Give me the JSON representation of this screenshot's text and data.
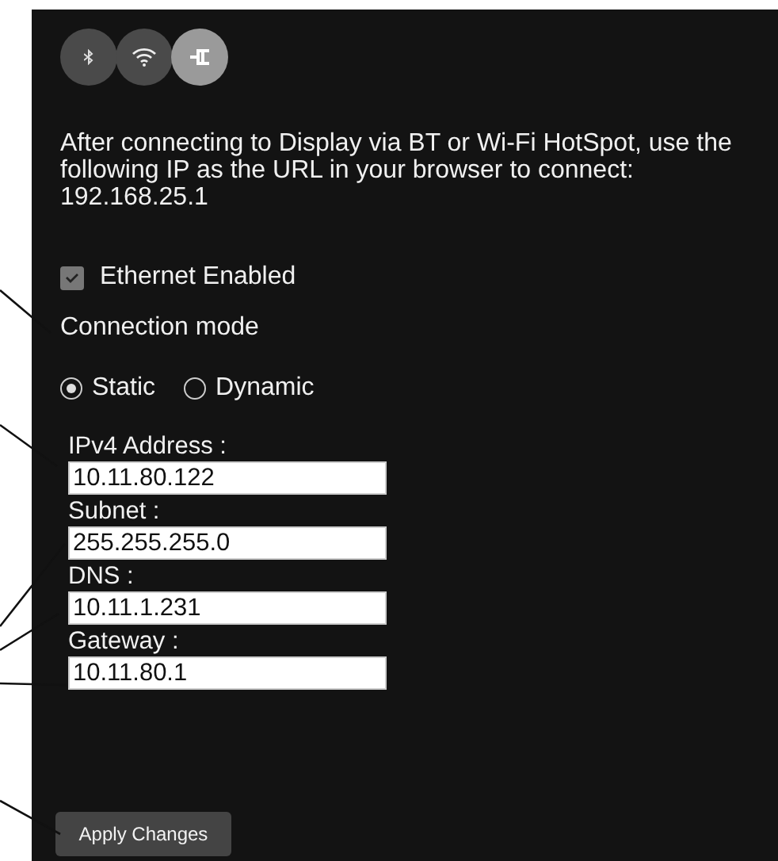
{
  "tabs": [
    {
      "kind": "bluetooth",
      "selected": false
    },
    {
      "kind": "wifi",
      "selected": false
    },
    {
      "kind": "ethernet",
      "selected": true
    }
  ],
  "info": "After connecting to Display via BT or Wi-Fi HotSpot, use the following IP as the URL in your browser to connect: 192.168.25.1",
  "ethernet_enabled": {
    "label": "Ethernet Enabled",
    "checked": true
  },
  "connection_mode": {
    "label": "Connection mode",
    "options": [
      {
        "label": "Static",
        "selected": true
      },
      {
        "label": "Dynamic",
        "selected": false
      }
    ]
  },
  "fields": [
    {
      "label": "IPv4 Address :",
      "value": "10.11.80.122"
    },
    {
      "label": "Subnet :",
      "value": "255.255.255.0"
    },
    {
      "label": "DNS :",
      "value": "10.11.1.231"
    },
    {
      "label": "Gateway :",
      "value": "10.11.80.1"
    }
  ],
  "apply_button": "Apply Changes"
}
